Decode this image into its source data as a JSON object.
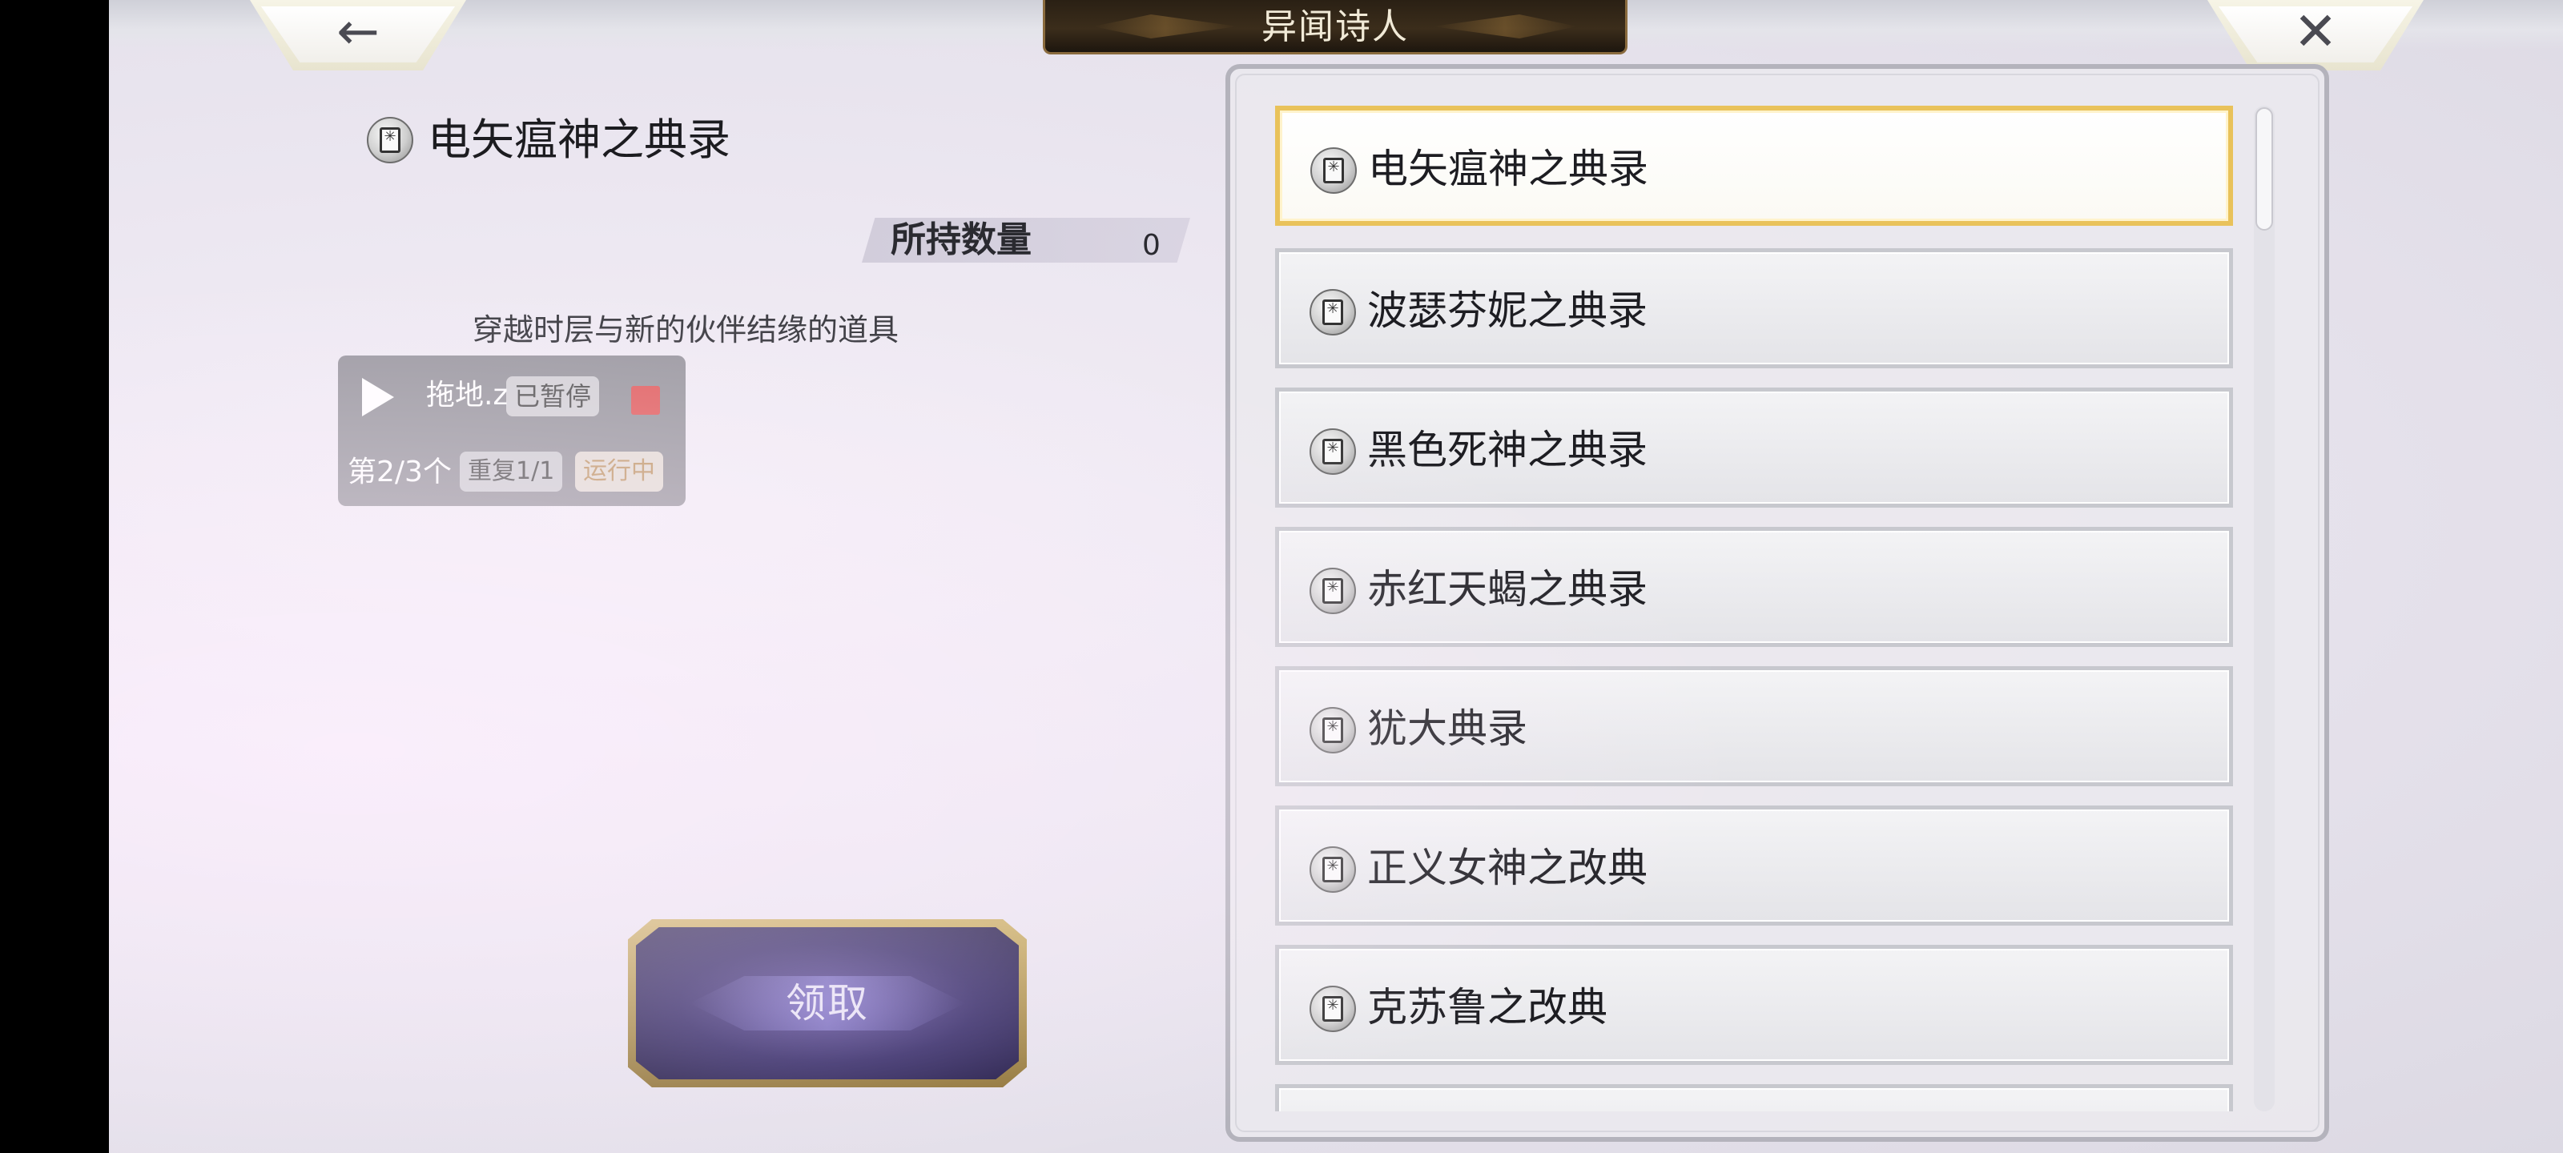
{
  "header": {
    "title": "异闻诗人",
    "back_icon": "back-arrow-icon",
    "close_icon": "close-x-icon"
  },
  "detail": {
    "title": "电矢瘟神之典录",
    "icon": "book-icon",
    "quantity_label": "所持数量",
    "quantity_value": "0",
    "description": "穿越时层与新的伙伴结缘的道具"
  },
  "overlay": {
    "play_icon": "play-icon",
    "name": "拖地.z",
    "paused": "已暂停",
    "stop_icon": "stop-icon",
    "progress": "第2/3个",
    "repeat": "重复1/1",
    "running": "运行中"
  },
  "claim_button": {
    "label": "领取"
  },
  "list": {
    "selected_index": 0,
    "items": [
      {
        "label": "电矢瘟神之典录"
      },
      {
        "label": "波瑟芬妮之典录"
      },
      {
        "label": "黑色死神之典录"
      },
      {
        "label": "赤红天蝎之典录"
      },
      {
        "label": "犹大典录"
      },
      {
        "label": "正义女神之改典"
      },
      {
        "label": "克苏鲁之改典"
      },
      {
        "label": ""
      }
    ]
  },
  "colors": {
    "selected_border": "#e9c25a",
    "title_plate": "#2a2014",
    "claim_button": "#2b2160",
    "stop_button": "#e06060"
  }
}
